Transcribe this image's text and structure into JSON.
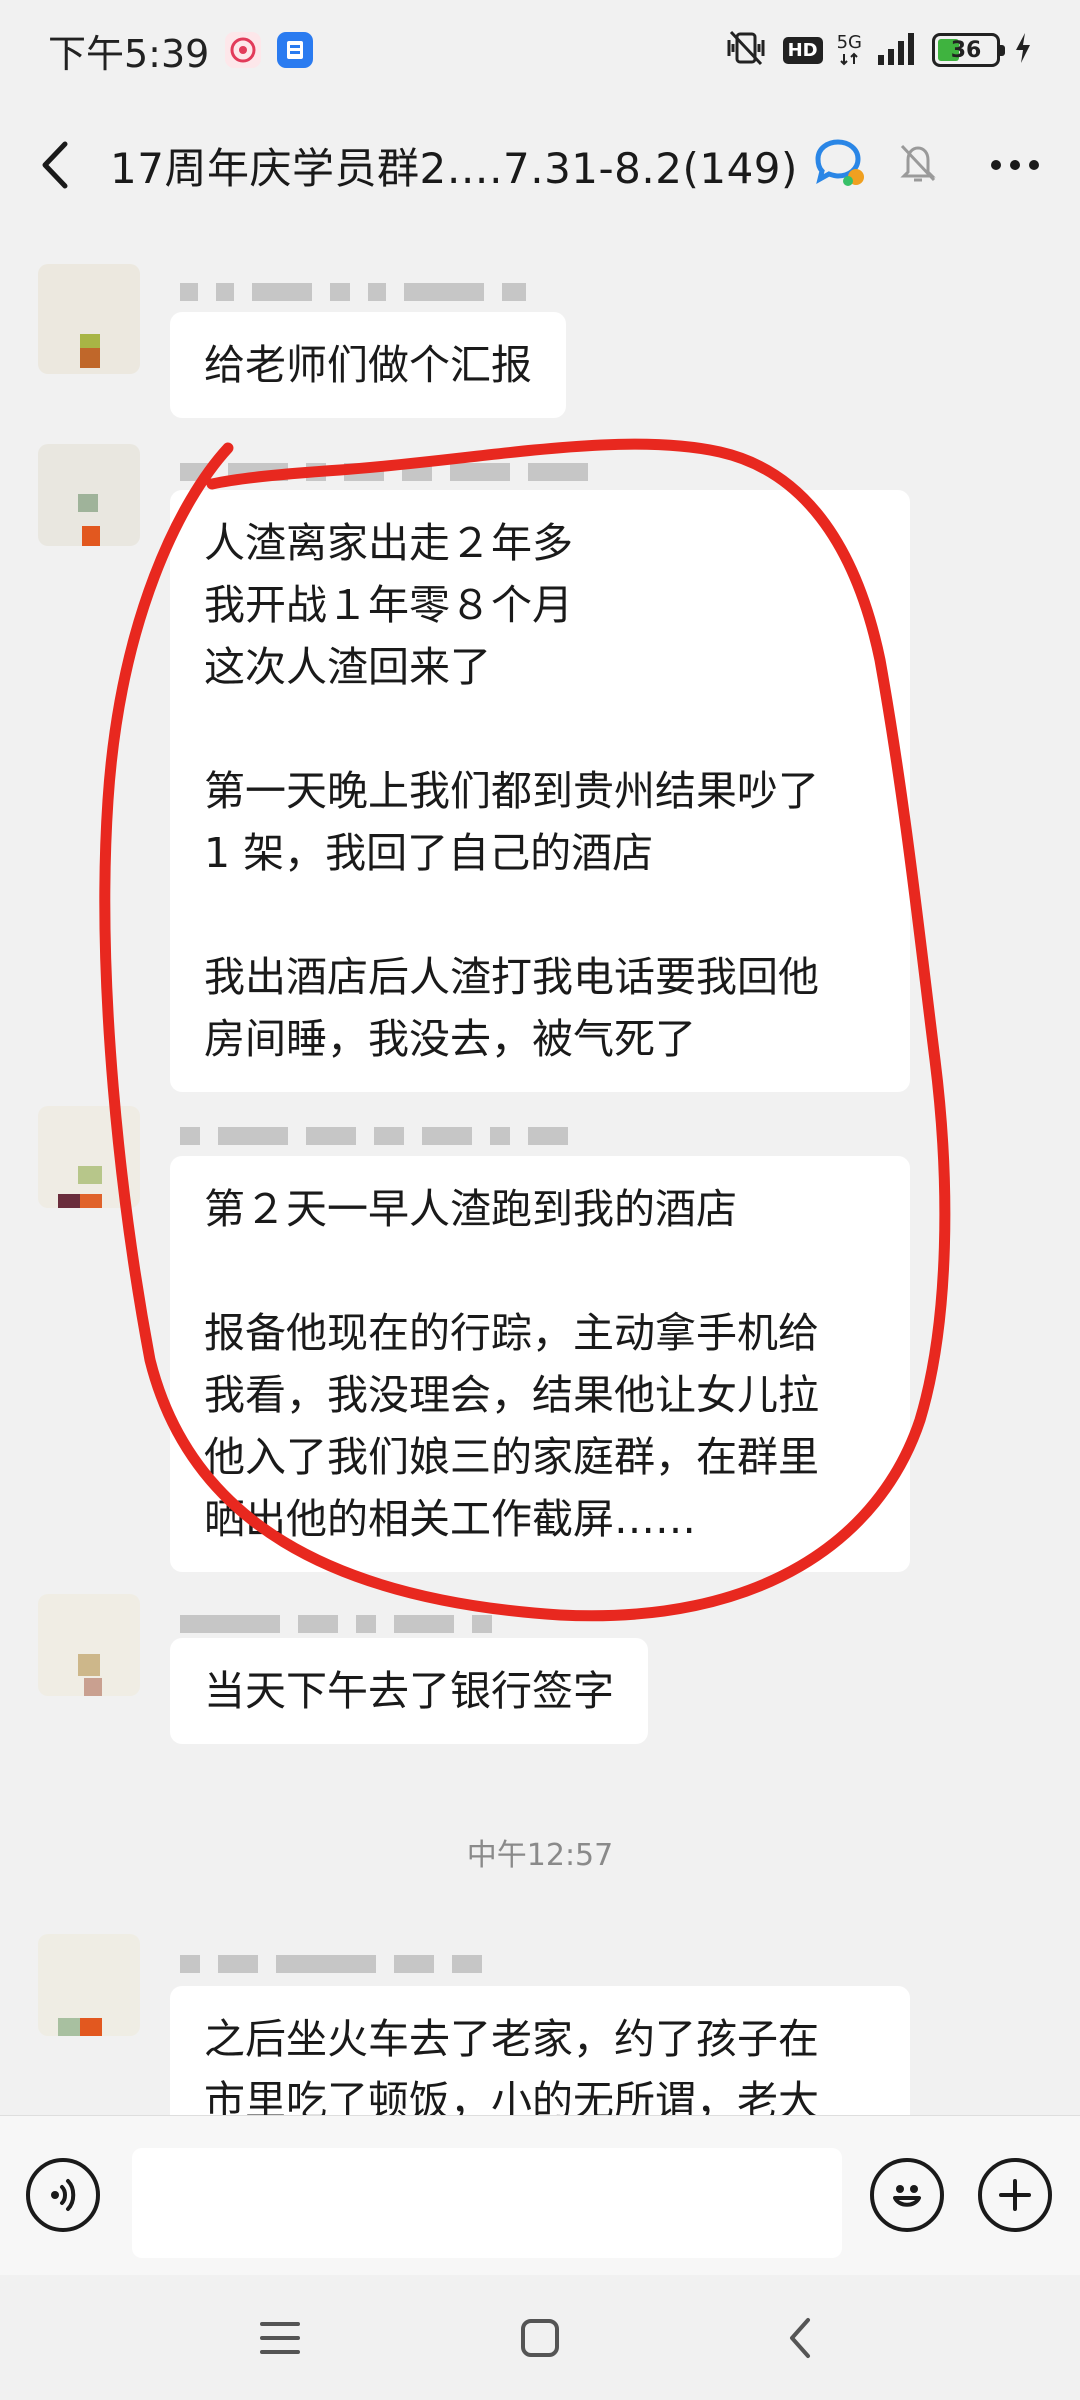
{
  "status_bar": {
    "time": "下午5:39",
    "network": "5G",
    "hd_label": "HD",
    "battery": "36"
  },
  "header": {
    "title": "17周年庆学员群2….7.31-8.2(149)",
    "back_icon": "chevron-left-icon",
    "mute_icon": "bell-off-icon",
    "more_icon": "more-dots-icon"
  },
  "messages": [
    {
      "text": "给老师们做个汇报"
    },
    {
      "text": "人渣离家出走２年多\n我开战１年零８个月\n这次人渣回来了\n\n第一天晚上我们都到贵州结果吵了\n1 架，我回了自己的酒店\n\n我出酒店后人渣打我电话要我回他\n房间睡，我没去，被气死了"
    },
    {
      "text": "第２天一早人渣跑到我的酒店\n\n报备他现在的行踪，主动拿手机给\n我看，我没理会，结果他让女儿拉\n他入了我们娘三的家庭群，在群里\n晒出他的相关工作截屏……"
    },
    {
      "text": "当天下午去了银行签字"
    },
    {
      "text": "之后坐火车去了老家，约了孩子在\n市里吃了顿饭，小的无所谓，老大"
    }
  ],
  "time_divider": "中午12:57",
  "input_bar": {
    "voice_icon": "voice-icon",
    "emoji_icon": "emoji-icon",
    "add_icon": "add-icon",
    "placeholder": ""
  },
  "nav_bar": {
    "menu_icon": "menu-icon",
    "home_icon": "home-icon",
    "back_icon": "back-icon"
  },
  "colors": {
    "background": "#f1f1f1",
    "bubble": "#ffffff",
    "annotation_red": "#e8281f",
    "battery_green": "#3fb33f"
  }
}
